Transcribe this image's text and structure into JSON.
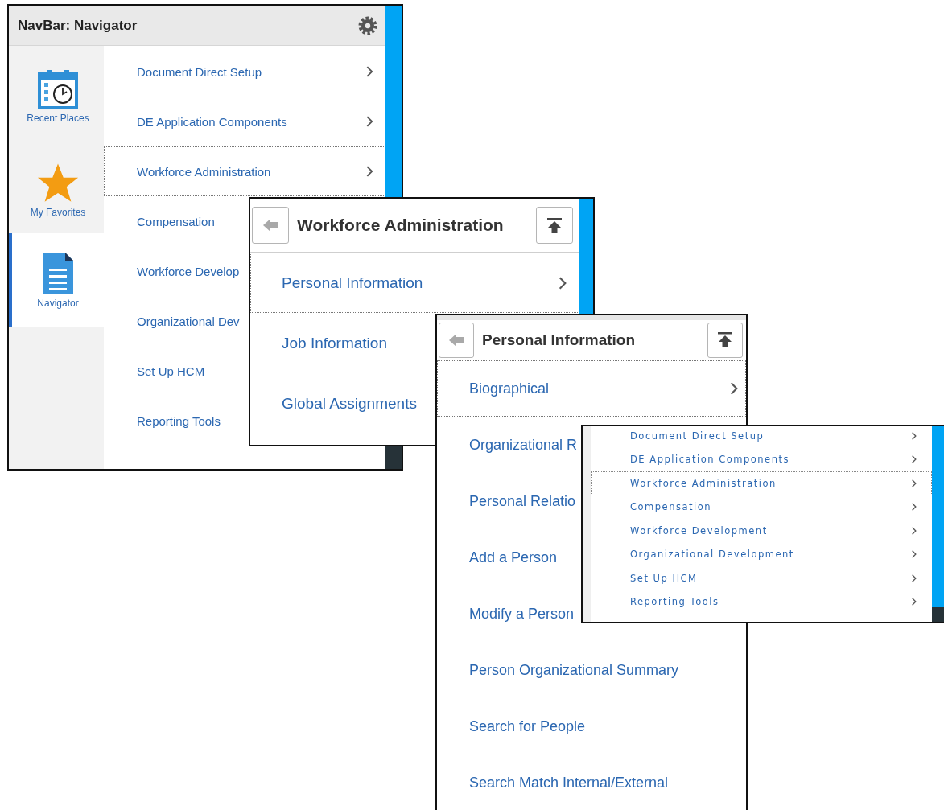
{
  "navbar": {
    "title": "NavBar: Navigator",
    "tiles": [
      {
        "kind": "recent",
        "label": "Recent Places",
        "selected": false
      },
      {
        "kind": "favorites",
        "label": "My Favorites",
        "selected": false
      },
      {
        "kind": "navigator",
        "label": "Navigator",
        "selected": true
      }
    ],
    "items": [
      {
        "label": "Document Direct Setup",
        "selected": false,
        "expandable": true
      },
      {
        "label": "DE Application Components",
        "selected": false,
        "expandable": true
      },
      {
        "label": "Workforce Administration",
        "selected": true,
        "expandable": true
      },
      {
        "label": "Compensation",
        "selected": false
      },
      {
        "label": "Workforce Develop",
        "selected": false
      },
      {
        "label": "Organizational Dev",
        "selected": false
      },
      {
        "label": "Set Up HCM",
        "selected": false
      },
      {
        "label": "Reporting Tools",
        "selected": false
      }
    ]
  },
  "workforce_panel": {
    "title": "Workforce Administration",
    "items": [
      {
        "label": "Personal Information",
        "selected": true,
        "expandable": true
      },
      {
        "label": "Job Information",
        "selected": false
      },
      {
        "label": "Global Assignments",
        "selected": false
      }
    ]
  },
  "personal_panel": {
    "title": "Personal Information",
    "items": [
      {
        "label": "Biographical",
        "selected": true,
        "expandable": true
      },
      {
        "label": "Organizational R",
        "selected": false
      },
      {
        "label": "Personal Relatio",
        "selected": false
      },
      {
        "label": "Add a Person",
        "selected": false
      },
      {
        "label": "Modify a Person",
        "selected": false,
        "expandable": false
      },
      {
        "label": "Person Organizational Summary",
        "selected": false,
        "expandable": false
      },
      {
        "label": "Search for People",
        "selected": false,
        "expandable": false
      },
      {
        "label": "Search Match Internal/External",
        "selected": false,
        "expandable": false
      }
    ]
  },
  "navigator_preview": {
    "items": [
      {
        "label": "Document Direct Setup",
        "selected": false,
        "expandable": true
      },
      {
        "label": "DE Application Components",
        "selected": false,
        "expandable": true
      },
      {
        "label": "Workforce Administration",
        "selected": true,
        "expandable": true
      },
      {
        "label": "Compensation",
        "selected": false,
        "expandable": true
      },
      {
        "label": "Workforce Development",
        "selected": false,
        "expandable": true
      },
      {
        "label": "Organizational Development",
        "selected": false,
        "expandable": true
      },
      {
        "label": "Set Up HCM",
        "selected": false,
        "expandable": true
      },
      {
        "label": "Reporting Tools",
        "selected": false,
        "expandable": true
      }
    ]
  }
}
